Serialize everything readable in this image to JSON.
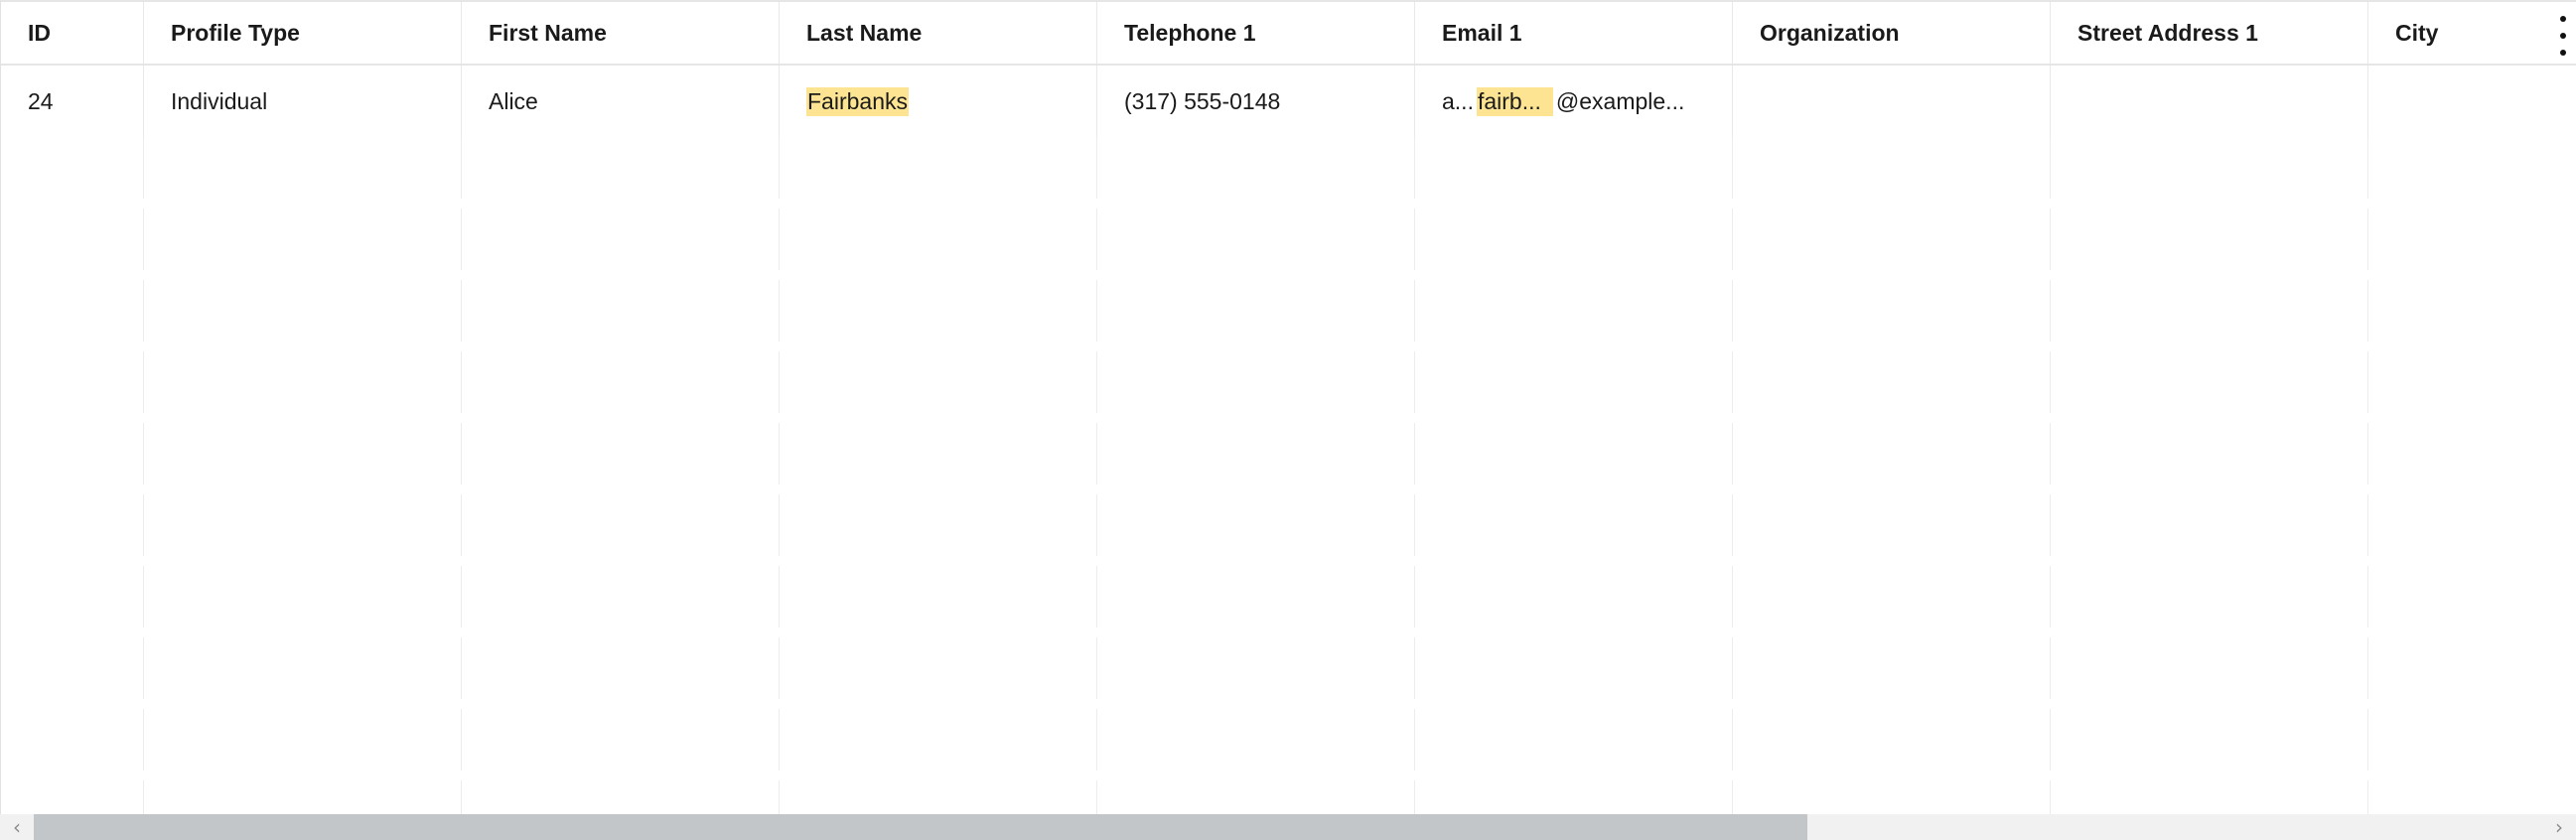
{
  "table": {
    "columns": [
      {
        "key": "id",
        "label": "ID"
      },
      {
        "key": "profile_type",
        "label": "Profile Type"
      },
      {
        "key": "first_name",
        "label": "First Name"
      },
      {
        "key": "last_name",
        "label": "Last Name"
      },
      {
        "key": "telephone_1",
        "label": "Telephone 1"
      },
      {
        "key": "email_1",
        "label": "Email 1"
      },
      {
        "key": "organization",
        "label": "Organization"
      },
      {
        "key": "street_address_1",
        "label": "Street Address 1"
      },
      {
        "key": "city",
        "label": "City"
      }
    ],
    "rows": [
      {
        "id": "24",
        "profile_type": "Individual",
        "first_name": "Alice",
        "last_name": "Fairbanks",
        "telephone_1": "(317) 555-0148",
        "email_1_prefix": "a...",
        "email_1_match": "fairb...",
        "email_1_suffix": "@example...",
        "organization": "",
        "street_address_1": "",
        "city": ""
      }
    ],
    "highlight_color": "#fde492",
    "column_menu_icon": "kebab-menu-icon"
  },
  "scrollbar": {
    "left_arrow": "‹",
    "right_arrow": "›"
  }
}
